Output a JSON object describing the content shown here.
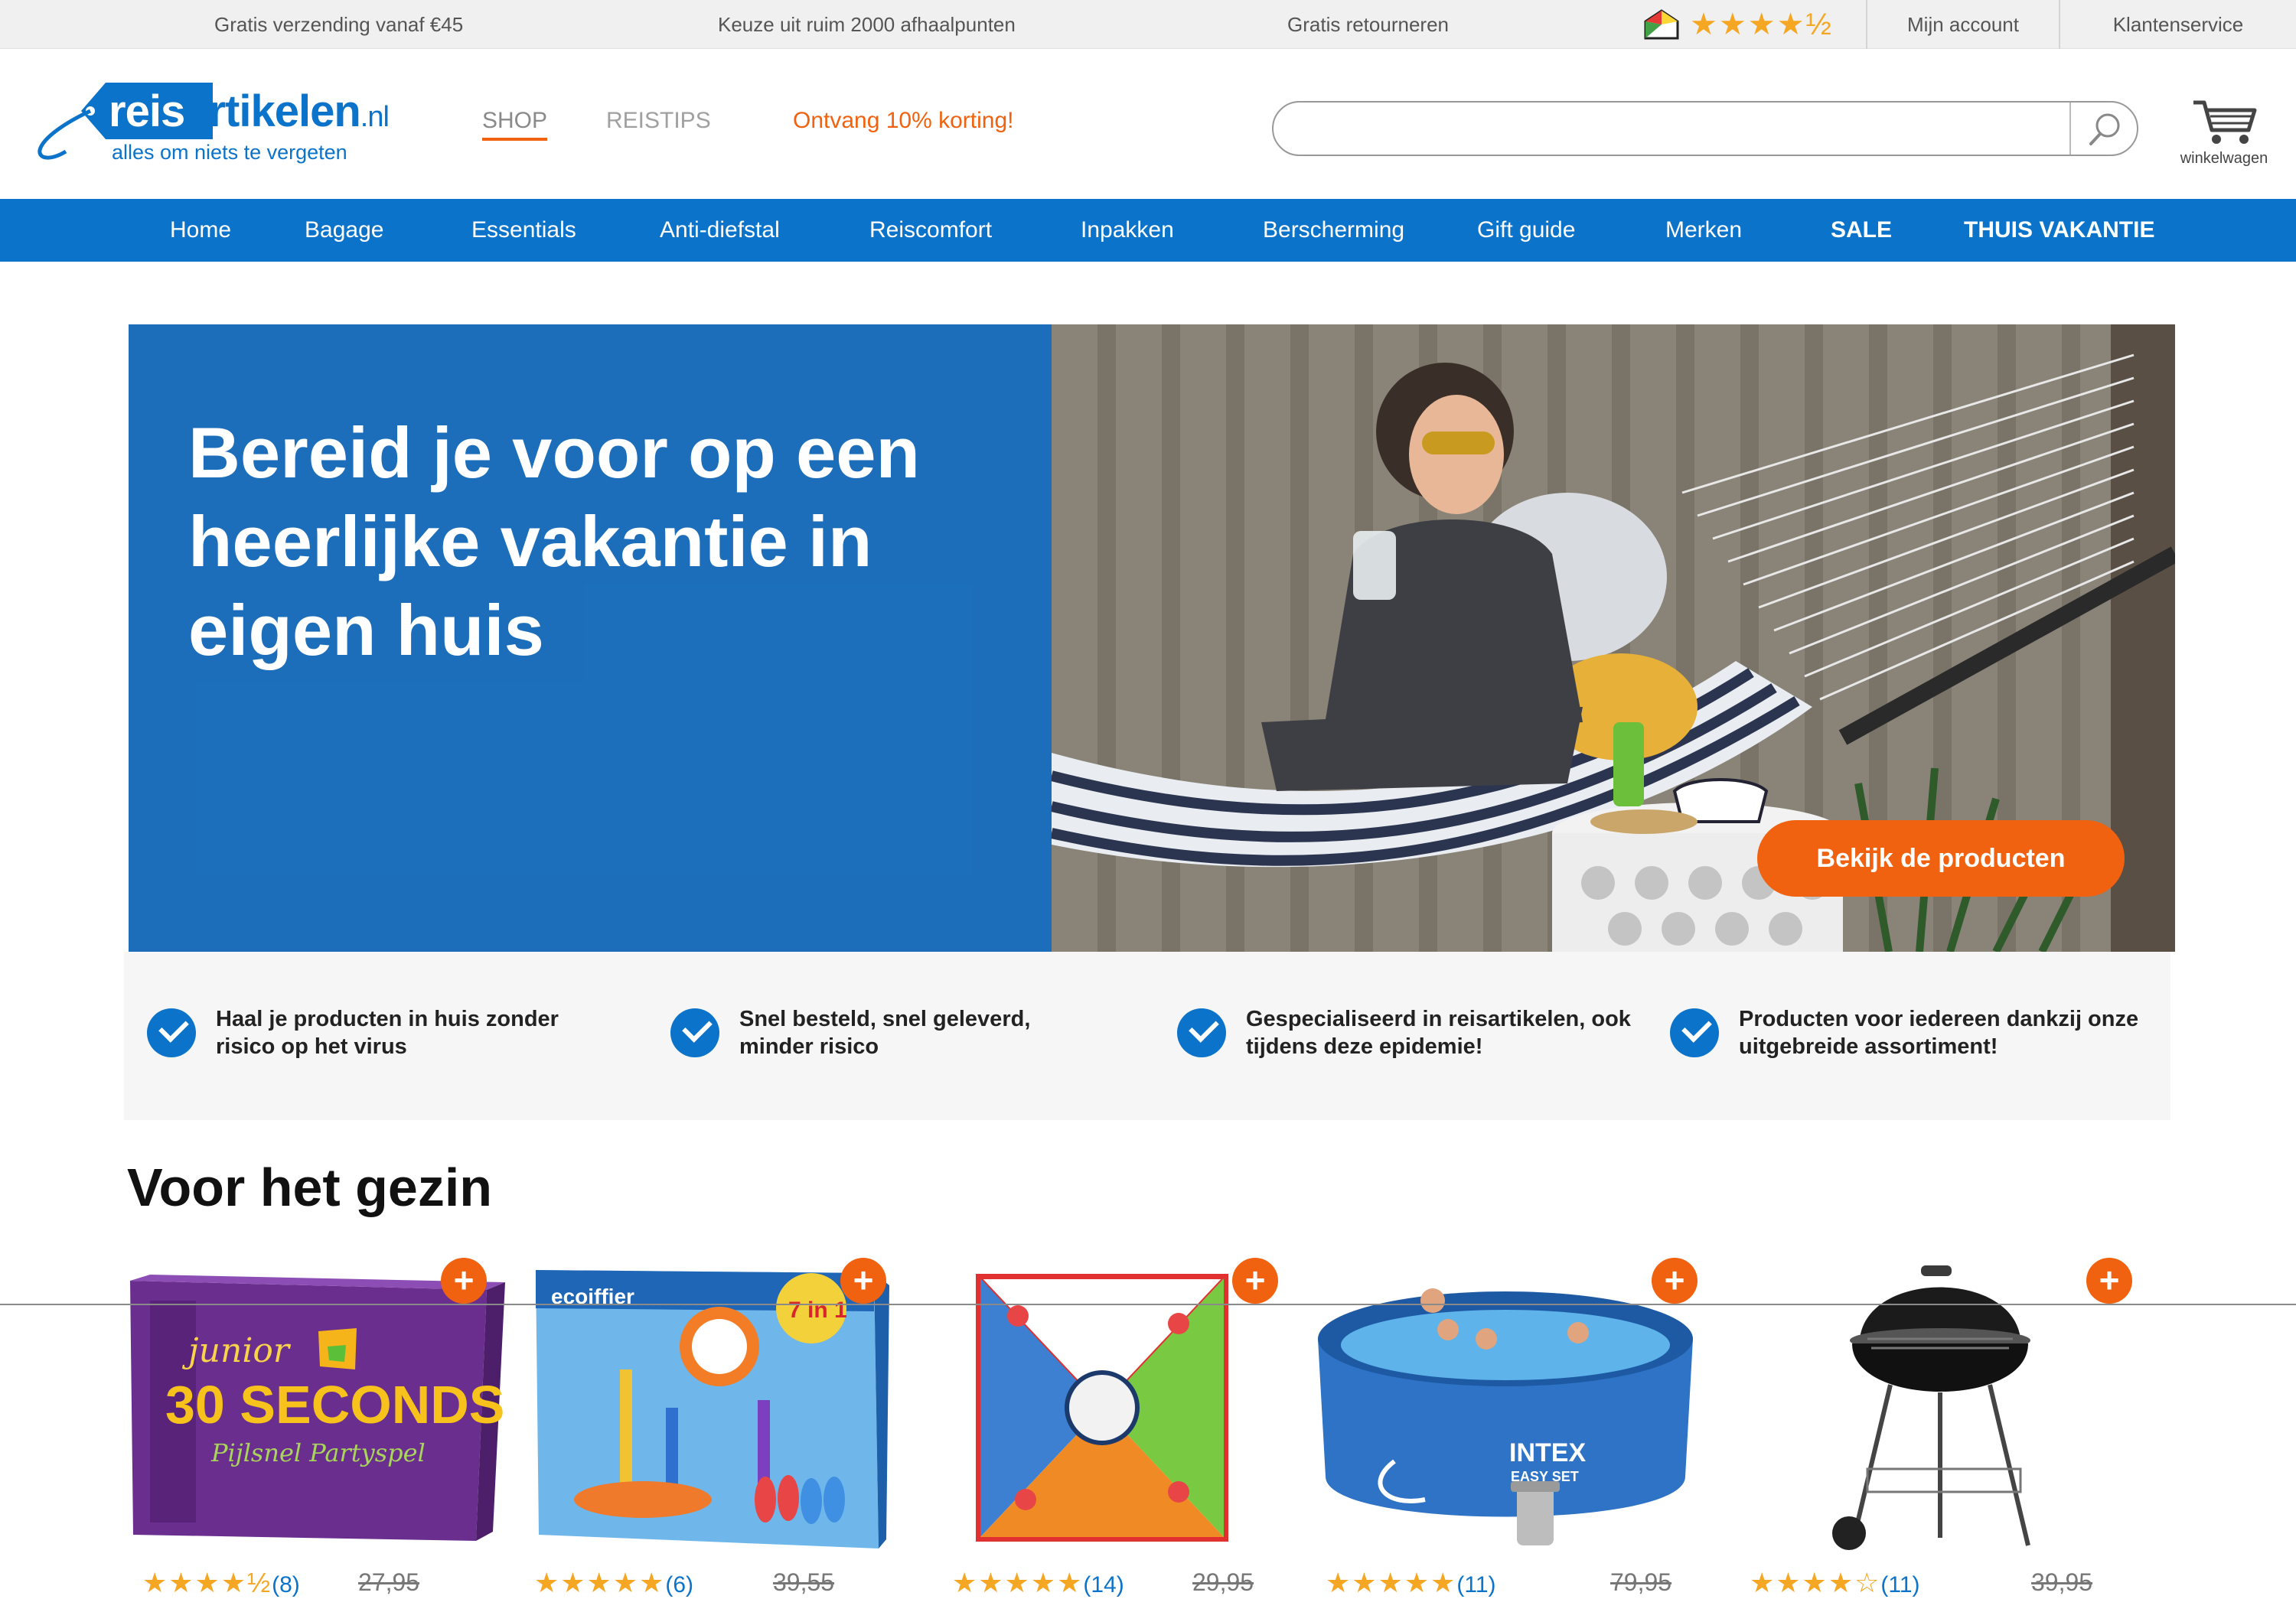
{
  "topbar": {
    "usps": [
      "Gratis verzending vanaf €45",
      "Keuze uit ruim 2000 afhaalpunten",
      "Gratis retourneren"
    ],
    "rating_stars": "★★★★½",
    "links": {
      "account": "Mijn account",
      "service": "Klantenservice"
    }
  },
  "header": {
    "logo": {
      "part1": "reis",
      "part2": "artikelen",
      "part3": ".nl",
      "tagline": "alles om niets te vergeten"
    },
    "nav": {
      "shop": "SHOP",
      "tips": "REISTIPS",
      "promo": "Ontvang 10% korting!"
    },
    "search": {
      "placeholder": "",
      "value": ""
    },
    "cart_label": "winkelwagen"
  },
  "mainnav": [
    "Home",
    "Bagage",
    "Essentials",
    "Anti-diefstal",
    "Reiscomfort",
    "Inpakken",
    "Berscherming",
    "Gift guide",
    "Merken",
    "SALE",
    "THUIS VAKANTIE"
  ],
  "hero": {
    "headline": "Bereid je voor op een heerlijke vakantie in eigen huis",
    "cta": "Bekijk de producten"
  },
  "usps": [
    "Haal je producten in huis zonder risico op het virus",
    "Snel besteld, snel geleverd, minder risico",
    "Gespecialiseerd in reisartikelen, ook tijdens deze epidemie!",
    "Producten voor iedereen dankzij onze uitgebreide assortiment!"
  ],
  "products": {
    "title": "Voor het gezin",
    "add_symbol": "+",
    "items": [
      {
        "image": "30 Seconds junior board game",
        "box_text_1": "junior",
        "box_text_2": "30 SECONDS",
        "box_text_3": "Pijlsnel Partyspel",
        "stars": "★★★★½",
        "reviews": "(8)",
        "old_price": "27,95"
      },
      {
        "image": "Ecoiffier 7-in-1 sport game set",
        "box_text_1": "ecoiffier",
        "box_text_2": "7 in 1",
        "stars": "★★★★★",
        "reviews": "(6)",
        "old_price": "39,55"
      },
      {
        "image": "OffBeat party game",
        "stars": "★★★★★",
        "reviews": "(14)",
        "old_price": "29,95"
      },
      {
        "image": "Intex Easy Set pool",
        "box_text_1": "INTEX",
        "box_text_2": "EASY SET",
        "stars": "★★★★★",
        "reviews": "(11)",
        "old_price": "79,95"
      },
      {
        "image": "Kettle barbecue",
        "stars": "★★★★☆",
        "reviews": "(11)",
        "old_price": "39,95"
      }
    ]
  },
  "colors": {
    "brand_blue": "#0b73c9",
    "accent_orange": "#f0620f",
    "star": "#f5a623"
  }
}
